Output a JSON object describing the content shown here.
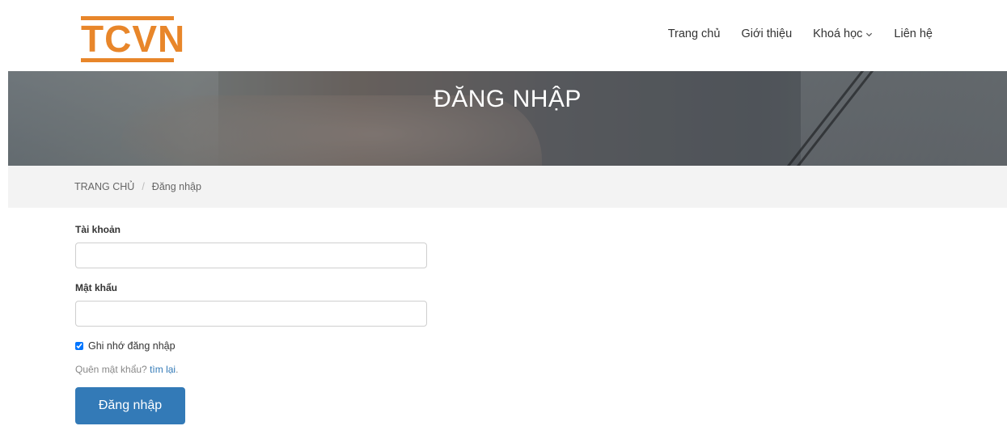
{
  "logo": {
    "text": "TCVN",
    "color": "#e8862a"
  },
  "nav": {
    "items": [
      {
        "label": "Trang chủ"
      },
      {
        "label": "Giới thiệu"
      },
      {
        "label": "Khoá học",
        "icon": "chevron-down-icon"
      },
      {
        "label": "Liên hệ"
      }
    ]
  },
  "banner": {
    "title": "ĐĂNG NHẬP"
  },
  "breadcrumb": {
    "home": "TRANG CHỦ",
    "separator": "/",
    "current": "Đăng nhập"
  },
  "form": {
    "username_label": "Tài khoản",
    "username_value": "",
    "password_label": "Mật khẩu",
    "password_value": "",
    "remember_label": "Ghi nhớ đăng nhập",
    "remember_checked": true,
    "forgot_text": "Quên mật khẩu?",
    "forgot_link": "tìm lại",
    "forgot_suffix": ".",
    "submit_label": "Đăng nhập"
  },
  "colors": {
    "accent": "#e8862a",
    "primary": "#337ab7",
    "breadcrumb_bg": "#f3f3f3"
  }
}
